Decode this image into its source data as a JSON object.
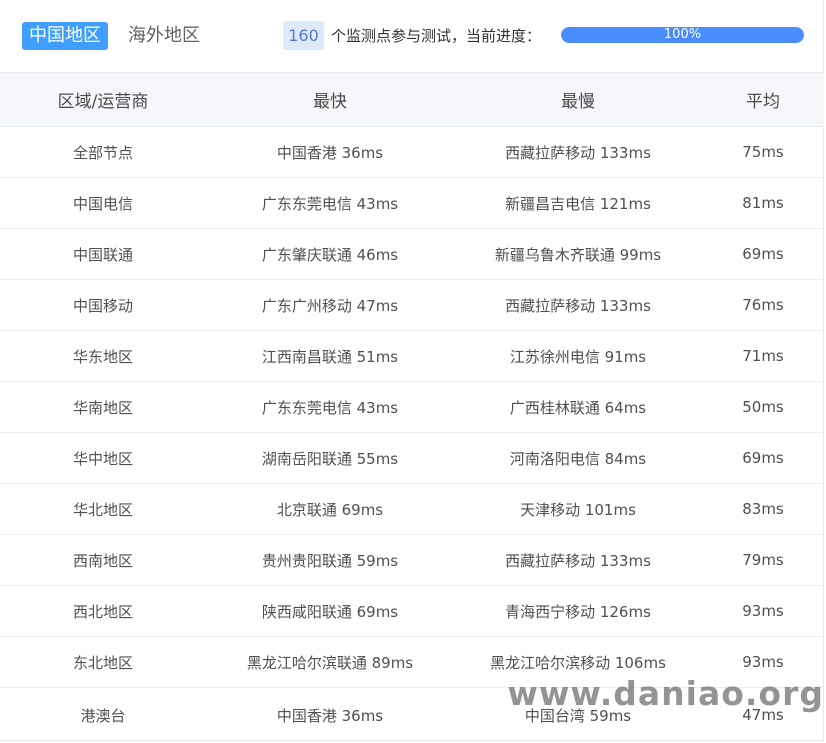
{
  "tabs": {
    "active": "中国地区",
    "inactive": "海外地区"
  },
  "status": {
    "count": "160",
    "text": "个监测点参与测试，当前进度：",
    "progress_label": "100%",
    "progress_value": 1.0
  },
  "table": {
    "headers": [
      "区域/运营商",
      "最快",
      "最慢",
      "平均"
    ],
    "rows": [
      [
        "全部节点",
        "中国香港 36ms",
        "西藏拉萨移动 133ms",
        "75ms"
      ],
      [
        "中国电信",
        "广东东莞电信 43ms",
        "新疆昌吉电信 121ms",
        "81ms"
      ],
      [
        "中国联通",
        "广东肇庆联通 46ms",
        "新疆乌鲁木齐联通 99ms",
        "69ms"
      ],
      [
        "中国移动",
        "广东广州移动 47ms",
        "西藏拉萨移动 133ms",
        "76ms"
      ],
      [
        "华东地区",
        "江西南昌联通 51ms",
        "江苏徐州电信 91ms",
        "71ms"
      ],
      [
        "华南地区",
        "广东东莞电信 43ms",
        "广西桂林联通 64ms",
        "50ms"
      ],
      [
        "华中地区",
        "湖南岳阳联通 55ms",
        "河南洛阳电信 84ms",
        "69ms"
      ],
      [
        "华北地区",
        "北京联通 69ms",
        "天津移动 101ms",
        "83ms"
      ],
      [
        "西南地区",
        "贵州贵阳联通 59ms",
        "西藏拉萨移动 133ms",
        "79ms"
      ],
      [
        "西北地区",
        "陕西咸阳联通 69ms",
        "青海西宁移动 126ms",
        "93ms"
      ],
      [
        "东北地区",
        "黑龙江哈尔滨联通 89ms",
        "黑龙江哈尔滨移动 106ms",
        "93ms"
      ],
      [
        "港澳台",
        "中国香港 36ms",
        "中国台湾 59ms",
        "47ms"
      ]
    ]
  },
  "watermark": "www.daniao.org",
  "colors": {
    "accent": "#409eff",
    "progress": "#4a8dff",
    "badge_bg": "#dfeaf9",
    "badge_text": "#4d7bd6",
    "header_bg": "#f5f7fa"
  }
}
